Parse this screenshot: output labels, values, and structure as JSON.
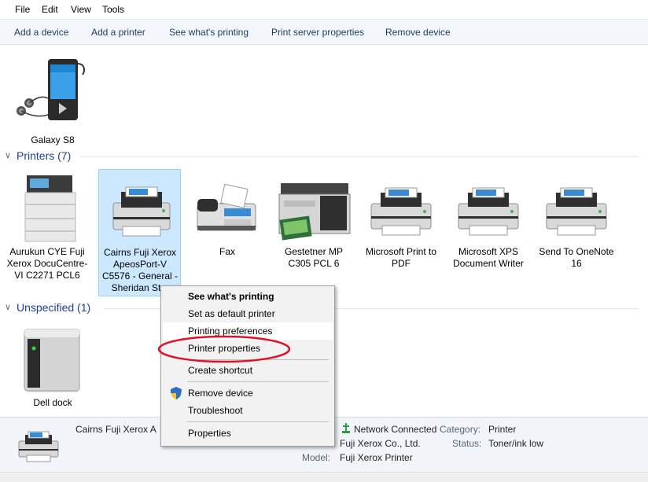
{
  "menu": [
    "File",
    "Edit",
    "View",
    "Tools"
  ],
  "toolbar": [
    "Add a device",
    "Add a printer",
    "See what's printing",
    "Print server properties",
    "Remove device"
  ],
  "devices_group": {
    "items": [
      {
        "label": "Galaxy S8",
        "icon": "phone-icon"
      }
    ]
  },
  "printers_group": {
    "title": "Printers (7)",
    "items": [
      {
        "label": "Aurukun CYE Fuji Xerox DocuCentre-VI C2271 PCL6",
        "icon": "mfp-printer-icon"
      },
      {
        "label": "Cairns Fuji Xerox ApeosPort-V C5576 - General - Sheridan St o",
        "icon": "printer-icon"
      },
      {
        "label": "Fax",
        "icon": "fax-icon"
      },
      {
        "label": "Gestetner MP C305 PCL 6",
        "icon": "copier-icon"
      },
      {
        "label": "Microsoft Print to PDF",
        "icon": "printer-icon"
      },
      {
        "label": "Microsoft XPS Document Writer",
        "icon": "printer-icon"
      },
      {
        "label": "Send To OneNote 16",
        "icon": "printer-icon"
      }
    ]
  },
  "unspecified_group": {
    "title": "Unspecified (1)",
    "items": [
      {
        "label": "Dell dock",
        "icon": "dock-icon"
      }
    ]
  },
  "context_menu": {
    "items": [
      {
        "label": "See what's printing"
      },
      {
        "label": "Set as default printer"
      },
      {
        "label": "Printing preferences"
      },
      {
        "label": "Printer properties"
      },
      {
        "label": "Create shortcut"
      },
      {
        "label": "Remove device",
        "icon": "shield-icon"
      },
      {
        "label": "Troubleshoot"
      },
      {
        "label": "Properties"
      }
    ],
    "highlight_color": "#e3102a"
  },
  "details": {
    "name": "Cairns Fuji Xerox A",
    "status_text": "Network Connected",
    "manufacturer": "Fuji Xerox Co., Ltd.",
    "model_label": "Model:",
    "model": "Fuji Xerox Printer",
    "category_label": "Category:",
    "category": "Printer",
    "status_label": "Status:",
    "status": "Toner/ink low"
  }
}
